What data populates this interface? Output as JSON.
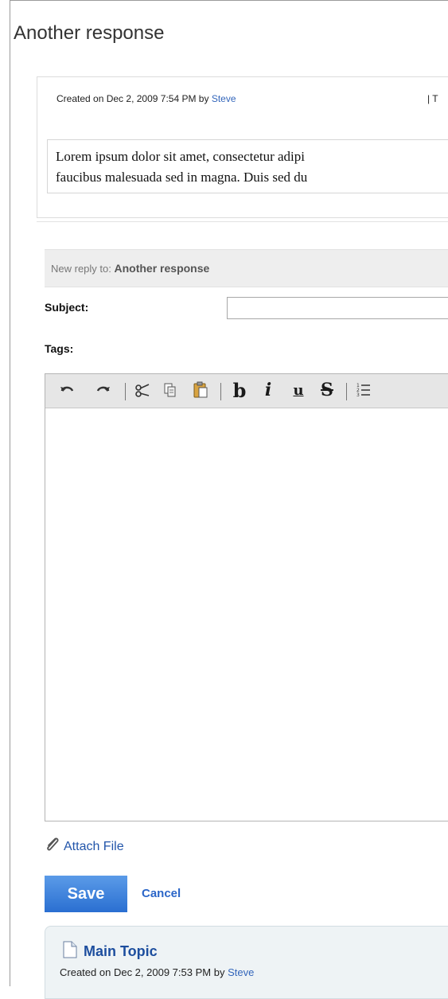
{
  "page_title": "Another response",
  "post": {
    "created_prefix": "Created on",
    "created_date": "Dec 2, 2009 7:54 PM",
    "by_word": "by",
    "author": "Steve",
    "meta_tail": "| T",
    "body_line1": "Lorem ipsum dolor sit amet, consectetur adipi",
    "body_line2": "faucibus malesuada sed in magna. Duis sed du"
  },
  "reply": {
    "prefix": "New reply to:",
    "title": "Another response",
    "subject_label": "Subject:",
    "subject_value": "",
    "tags_label": "Tags:"
  },
  "toolbar": {
    "icons": [
      "undo-icon",
      "redo-icon",
      "cut-icon",
      "copy-icon",
      "paste-icon",
      "bold-icon",
      "italic-icon",
      "underline-icon",
      "strikethrough-icon",
      "ordered-list-icon"
    ],
    "bold_glyph": "b",
    "italic_glyph": "i",
    "underline_glyph": "u",
    "strike_glyph": "S"
  },
  "attach_label": "Attach File",
  "save_label": "Save",
  "cancel_label": "Cancel",
  "topic": {
    "title": "Main Topic",
    "created_prefix": "Created on",
    "created_date": "Dec 2, 2009 7:53 PM",
    "by_word": "by",
    "author": "Steve"
  },
  "colors": {
    "link": "#3366bb",
    "save_button": "#2a6fd1",
    "topic_bg": "#eef3f5"
  }
}
